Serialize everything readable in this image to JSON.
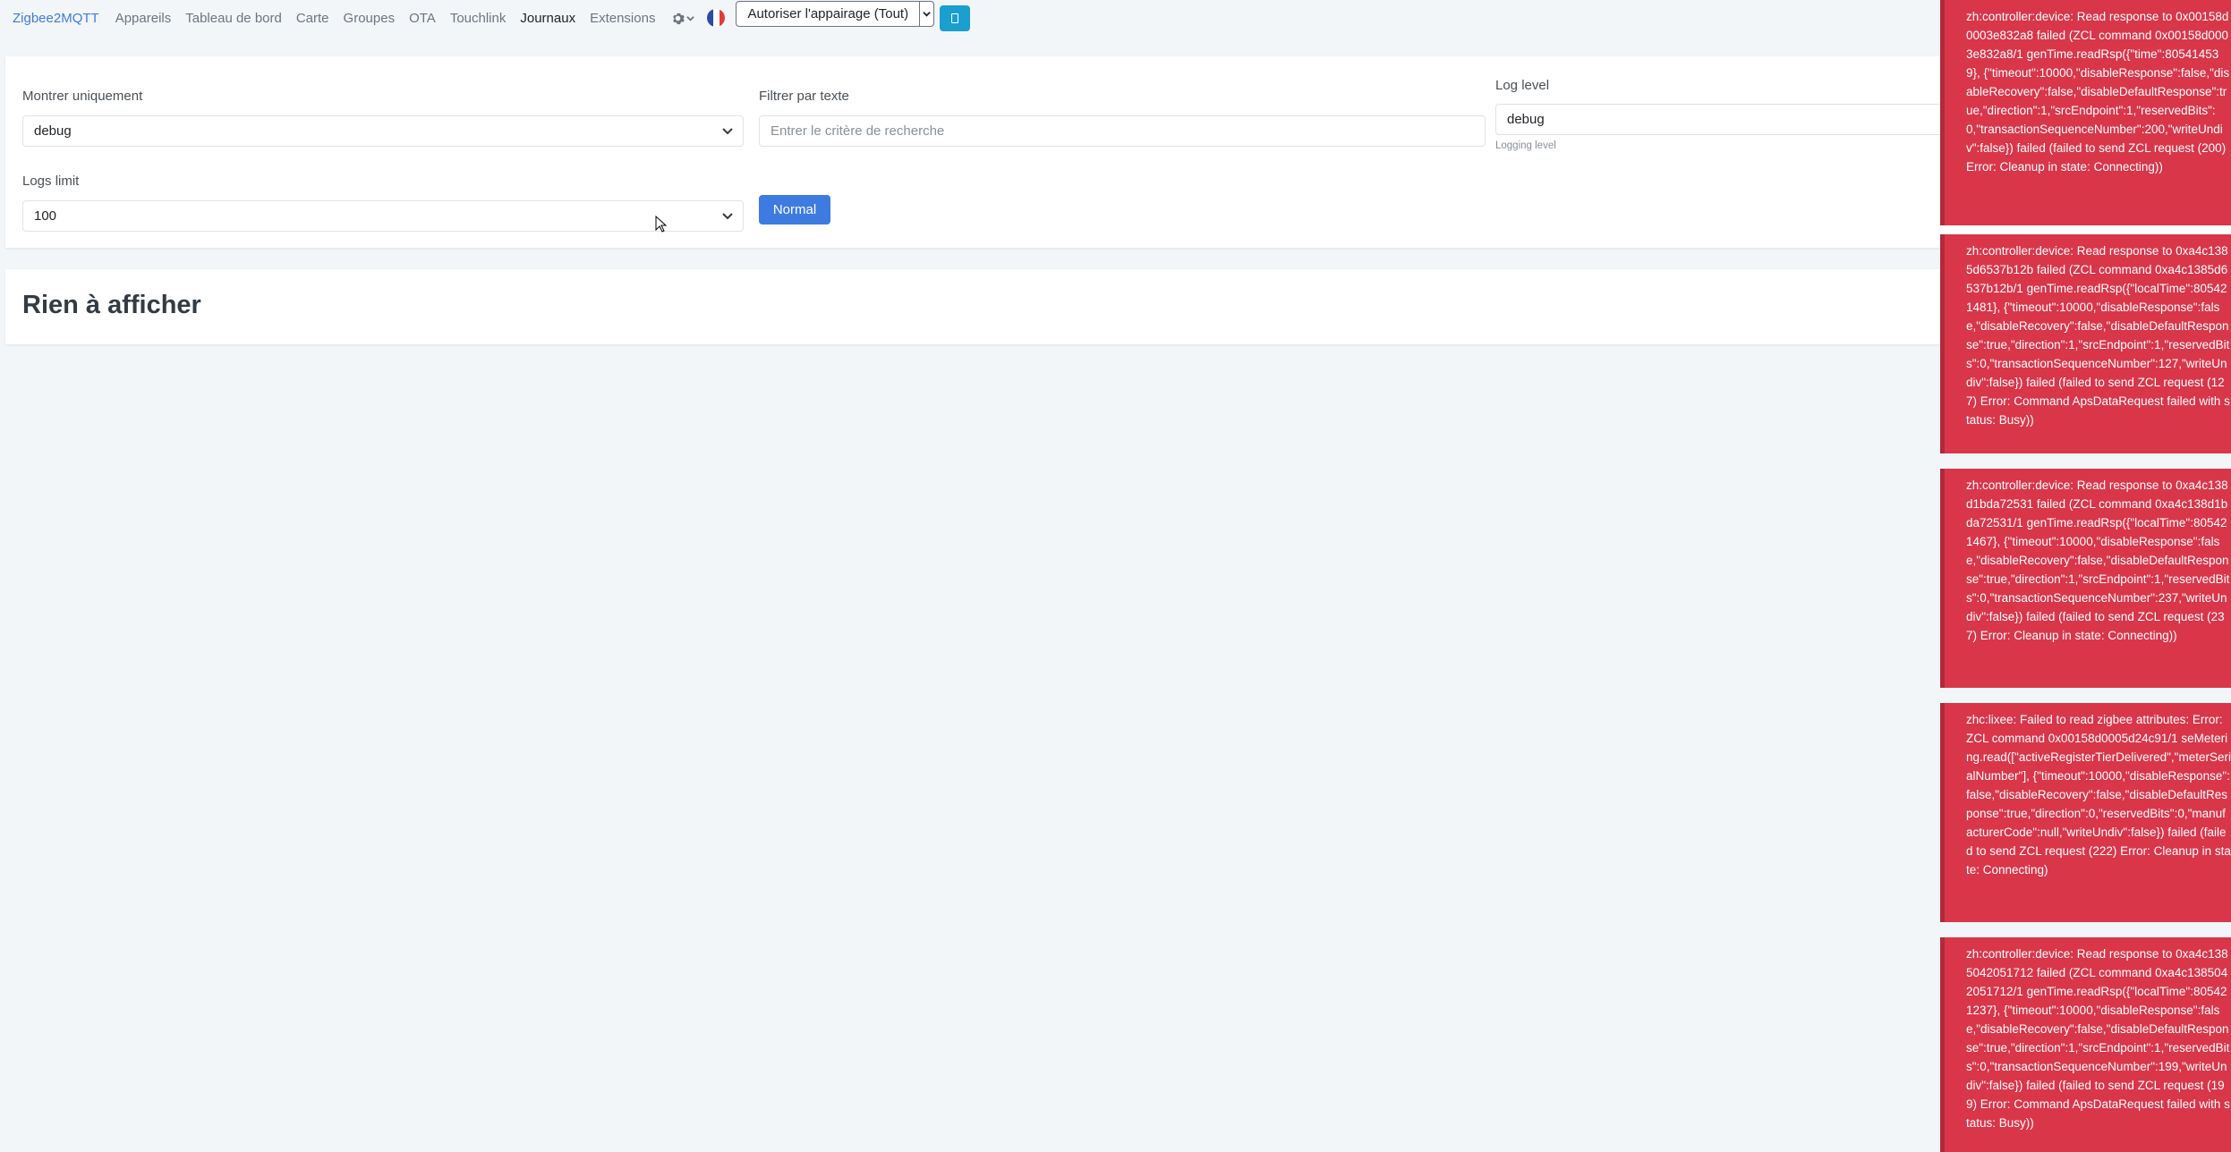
{
  "navbar": {
    "brand": "Zigbee2MQTT",
    "links": [
      "Appareils",
      "Tableau de bord",
      "Carte",
      "Groupes",
      "OTA",
      "Touchlink",
      "Journaux",
      "Extensions"
    ],
    "active_link": "Journaux",
    "pair_button": "Autoriser l'appairage (Tout)"
  },
  "filters": {
    "show_only_label": "Montrer uniquement",
    "show_only_value": "debug",
    "text_filter_label": "Filtrer par texte",
    "text_filter_placeholder": "Entrer le critère de recherche",
    "log_level_label": "Log level",
    "log_level_value": "debug",
    "log_level_help": "Logging level",
    "logs_limit_label": "Logs limit",
    "logs_limit_value": "100",
    "normal_button": "Normal"
  },
  "empty_message": "Rien à afficher",
  "toasts": [
    "zh:controller:device: Read response to 0x00158d0003e832a8 failed (ZCL command 0x00158d0003e832a8/1 genTime.readRsp({\"time\":805414539}, {\"timeout\":10000,\"disableResponse\":false,\"disableRecovery\":false,\"disableDefaultResponse\":true,\"direction\":1,\"srcEndpoint\":1,\"reservedBits\":0,\"transactionSequenceNumber\":200,\"writeUndiv\":false}) failed (failed to send ZCL request (200) Error: Cleanup in state: Connecting))",
    "zh:controller:device: Read response to 0xa4c1385d6537b12b failed (ZCL command 0xa4c1385d6537b12b/1 genTime.readRsp({\"localTime\":805421481}, {\"timeout\":10000,\"disableResponse\":false,\"disableRecovery\":false,\"disableDefaultResponse\":true,\"direction\":1,\"srcEndpoint\":1,\"reservedBits\":0,\"transactionSequenceNumber\":127,\"writeUndiv\":false}) failed (failed to send ZCL request (127) Error: Command ApsDataRequest failed with status: Busy))",
    "zh:controller:device: Read response to 0xa4c138d1bda72531 failed (ZCL command 0xa4c138d1bda72531/1 genTime.readRsp({\"localTime\":805421467}, {\"timeout\":10000,\"disableResponse\":false,\"disableRecovery\":false,\"disableDefaultResponse\":true,\"direction\":1,\"srcEndpoint\":1,\"reservedBits\":0,\"transactionSequenceNumber\":237,\"writeUndiv\":false}) failed (failed to send ZCL request (237) Error: Cleanup in state: Connecting))",
    "zhc:lixee: Failed to read zigbee attributes: Error: ZCL command 0x00158d0005d24c91/1 seMetering.read([\"activeRegisterTierDelivered\",\"meterSerialNumber\"], {\"timeout\":10000,\"disableResponse\":false,\"disableRecovery\":false,\"disableDefaultResponse\":true,\"direction\":0,\"reservedBits\":0,\"manufacturerCode\":null,\"writeUndiv\":false}) failed (failed to send ZCL request (222) Error: Cleanup in state: Connecting)",
    "zh:controller:device: Read response to 0xa4c1385042051712 failed (ZCL command 0xa4c1385042051712/1 genTime.readRsp({\"localTime\":805421237}, {\"timeout\":10000,\"disableResponse\":false,\"disableRecovery\":false,\"disableDefaultResponse\":true,\"direction\":1,\"srcEndpoint\":1,\"reservedBits\":0,\"transactionSequenceNumber\":199,\"writeUndiv\":false}) failed (failed to send ZCL request (199) Error: Command ApsDataRequest failed with status: Busy))"
  ],
  "colors": {
    "brand": "#3e7be0",
    "toast": "#d9364a",
    "primary_button": "#3e7be0",
    "info_button": "#1a9fcf"
  }
}
